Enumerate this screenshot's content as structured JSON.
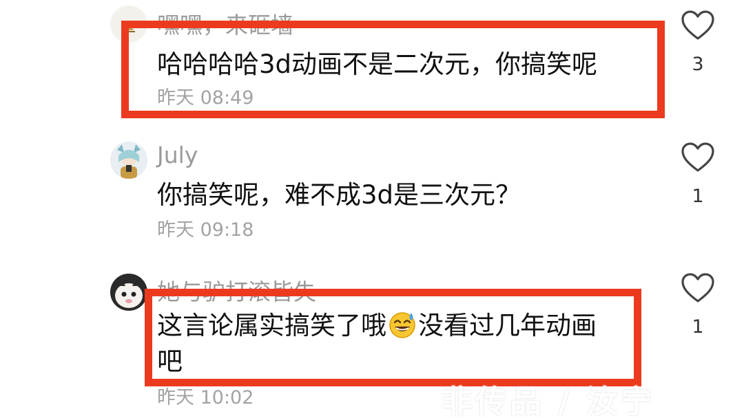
{
  "comments": [
    {
      "username": "嘿嘿，来砸墙",
      "text": "哈哈哈哈3d动画不是二次元，你搞笑呢",
      "time": "昨天 08:49",
      "likes": "3"
    },
    {
      "username": "July",
      "text": "你搞笑呢，难不成3d是三次元？",
      "time": "昨天 09:18",
      "likes": "1"
    },
    {
      "username": "她与驴打滚皆失",
      "text_part1": "这言论属实搞笑了哦",
      "emoji": "sweat-smile-emoji",
      "text_part2": "没看过几年动画",
      "text_line2": "吧",
      "time": "昨天 10:02",
      "likes": "1"
    }
  ],
  "watermark": "非传品 / 汝宁",
  "colors": {
    "highlight": "#ec3a1e",
    "username": "#9a9a9a",
    "time": "#a3a3a3",
    "text": "#111111"
  },
  "icons": {
    "like": "heart-outline-icon"
  }
}
